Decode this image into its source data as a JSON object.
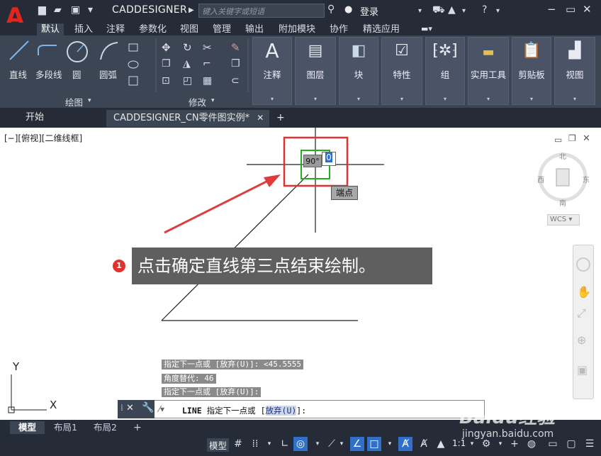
{
  "title_bar": {
    "app_title": "CADDESIGNER",
    "search_placeholder": "键入关键字或短语",
    "login": "登录"
  },
  "menu_tabs": [
    "默认",
    "插入",
    "注释",
    "参数化",
    "视图",
    "管理",
    "输出",
    "附加模块",
    "协作",
    "精选应用"
  ],
  "ribbon": {
    "draw": {
      "line": "直线",
      "polyline": "多段线",
      "circle": "圆",
      "arc": "圆弧",
      "panel": "绘图"
    },
    "modify": {
      "panel": "修改"
    },
    "big_buttons": [
      "注释",
      "图层",
      "块",
      "特性",
      "组",
      "实用工具",
      "剪贴板",
      "视图"
    ]
  },
  "file_tabs": {
    "start": "开始",
    "doc": "CADDESIGNER_CN零件图实例*",
    "close": "✕",
    "add": "+"
  },
  "viewport": {
    "label": "[−][俯视][二维线框]",
    "compass": {
      "n": "北",
      "s": "南",
      "w": "西",
      "e": "东"
    },
    "wcs": "WCS"
  },
  "dynamic_input": {
    "angle": "90°",
    "value": "0",
    "snap": "端点"
  },
  "callout": {
    "number": "1",
    "text": "点击确定直线第三点结束绘制。"
  },
  "command": {
    "history": [
      "指定下一点或 [放弃(U)]: <45.5555",
      "角度替代: 46",
      "指定下一点或 [放弃(U)]:"
    ],
    "prompt_cmd": "LINE",
    "prompt_text": "指定下一点或",
    "option": "放弃(U)",
    "tail": "]:",
    "open_bracket": "["
  },
  "layout_tabs": [
    "模型",
    "布局1",
    "布局2"
  ],
  "status": {
    "model": "模型",
    "scale": "1:1"
  },
  "watermark": {
    "brand": "Baidu经验",
    "url": "jingyan.baidu.com"
  },
  "axes": {
    "y": "Y",
    "x": "X"
  }
}
